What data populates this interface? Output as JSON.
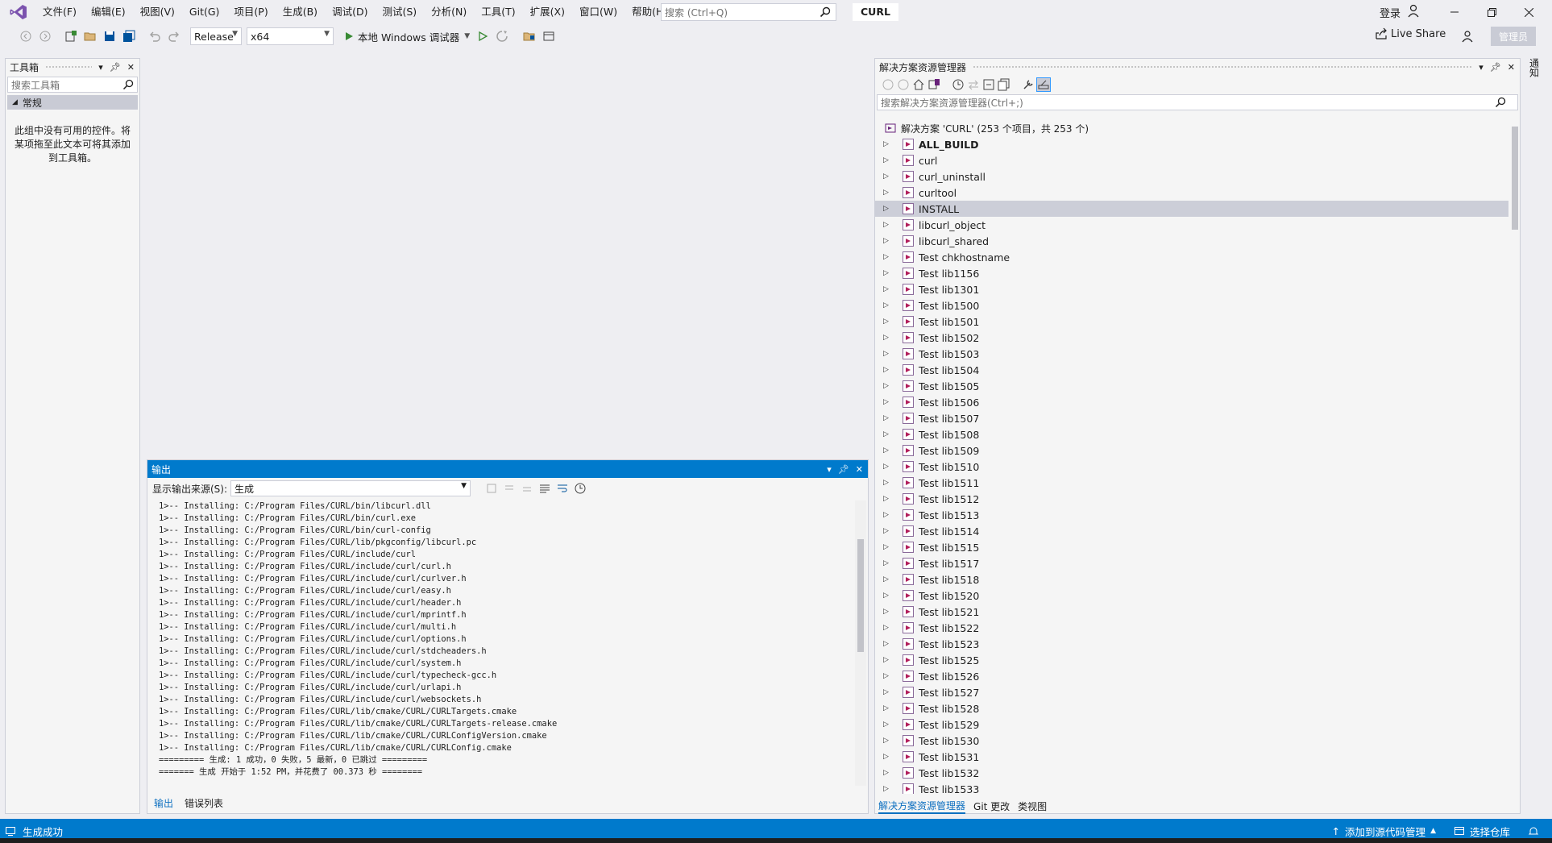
{
  "titlebar": {
    "menu": [
      "文件(F)",
      "编辑(E)",
      "视图(V)",
      "Git(G)",
      "项目(P)",
      "生成(B)",
      "调试(D)",
      "测试(S)",
      "分析(N)",
      "工具(T)",
      "扩展(X)",
      "窗口(W)",
      "帮助(H)"
    ],
    "search_placeholder": "搜索 (Ctrl+Q)",
    "project_name": "CURL",
    "signin": "登录"
  },
  "toolbar": {
    "config": "Release",
    "platform": "x64",
    "run_label": "本地 Windows 调试器",
    "live_share": "Live Share",
    "admin": "管理员"
  },
  "toolbox": {
    "title": "工具箱",
    "search_placeholder": "搜索工具箱",
    "group": "常规",
    "empty_text": "此组中没有可用的控件。将某项拖至此文本可将其添加到工具箱。"
  },
  "output": {
    "title": "输出",
    "source_label": "显示输出来源(S):",
    "source_value": "生成",
    "lines": [
      "1>-- Installing: C:/Program Files/CURL/bin/libcurl.dll",
      "1>-- Installing: C:/Program Files/CURL/bin/curl.exe",
      "1>-- Installing: C:/Program Files/CURL/bin/curl-config",
      "1>-- Installing: C:/Program Files/CURL/lib/pkgconfig/libcurl.pc",
      "1>-- Installing: C:/Program Files/CURL/include/curl",
      "1>-- Installing: C:/Program Files/CURL/include/curl/curl.h",
      "1>-- Installing: C:/Program Files/CURL/include/curl/curlver.h",
      "1>-- Installing: C:/Program Files/CURL/include/curl/easy.h",
      "1>-- Installing: C:/Program Files/CURL/include/curl/header.h",
      "1>-- Installing: C:/Program Files/CURL/include/curl/mprintf.h",
      "1>-- Installing: C:/Program Files/CURL/include/curl/multi.h",
      "1>-- Installing: C:/Program Files/CURL/include/curl/options.h",
      "1>-- Installing: C:/Program Files/CURL/include/curl/stdcheaders.h",
      "1>-- Installing: C:/Program Files/CURL/include/curl/system.h",
      "1>-- Installing: C:/Program Files/CURL/include/curl/typecheck-gcc.h",
      "1>-- Installing: C:/Program Files/CURL/include/curl/urlapi.h",
      "1>-- Installing: C:/Program Files/CURL/include/curl/websockets.h",
      "1>-- Installing: C:/Program Files/CURL/lib/cmake/CURL/CURLTargets.cmake",
      "1>-- Installing: C:/Program Files/CURL/lib/cmake/CURL/CURLTargets-release.cmake",
      "1>-- Installing: C:/Program Files/CURL/lib/cmake/CURL/CURLConfigVersion.cmake",
      "1>-- Installing: C:/Program Files/CURL/lib/cmake/CURL/CURLConfig.cmake",
      "========= 生成: 1 成功，0 失败，5 最新，0 已跳过 =========",
      "======= 生成 开始于 1:52 PM，并花费了 00.373 秒 ========"
    ],
    "tabs": [
      "输出",
      "错误列表"
    ]
  },
  "solution": {
    "title": "解决方案资源管理器",
    "search_placeholder": "搜索解决方案资源管理器(Ctrl+;)",
    "root": "解决方案 'CURL' (253 个项目，共 253 个)",
    "items": [
      "ALL_BUILD",
      "curl",
      "curl_uninstall",
      "curltool",
      "INSTALL",
      "libcurl_object",
      "libcurl_shared",
      "Test chkhostname",
      "Test lib1156",
      "Test lib1301",
      "Test lib1500",
      "Test lib1501",
      "Test lib1502",
      "Test lib1503",
      "Test lib1504",
      "Test lib1505",
      "Test lib1506",
      "Test lib1507",
      "Test lib1508",
      "Test lib1509",
      "Test lib1510",
      "Test lib1511",
      "Test lib1512",
      "Test lib1513",
      "Test lib1514",
      "Test lib1515",
      "Test lib1517",
      "Test lib1518",
      "Test lib1520",
      "Test lib1521",
      "Test lib1522",
      "Test lib1523",
      "Test lib1525",
      "Test lib1526",
      "Test lib1527",
      "Test lib1528",
      "Test lib1529",
      "Test lib1530",
      "Test lib1531",
      "Test lib1532",
      "Test lib1533"
    ],
    "selected": "INSTALL",
    "tabs": [
      "解决方案资源管理器",
      "Git 更改",
      "类视图"
    ]
  },
  "rightbar": {
    "label": "通知"
  },
  "status": {
    "left": "生成成功",
    "source_control": "添加到源代码管理",
    "repo": "选择仓库"
  },
  "colors": {
    "accent": "#007acc",
    "vs_purple": "#68217a"
  }
}
